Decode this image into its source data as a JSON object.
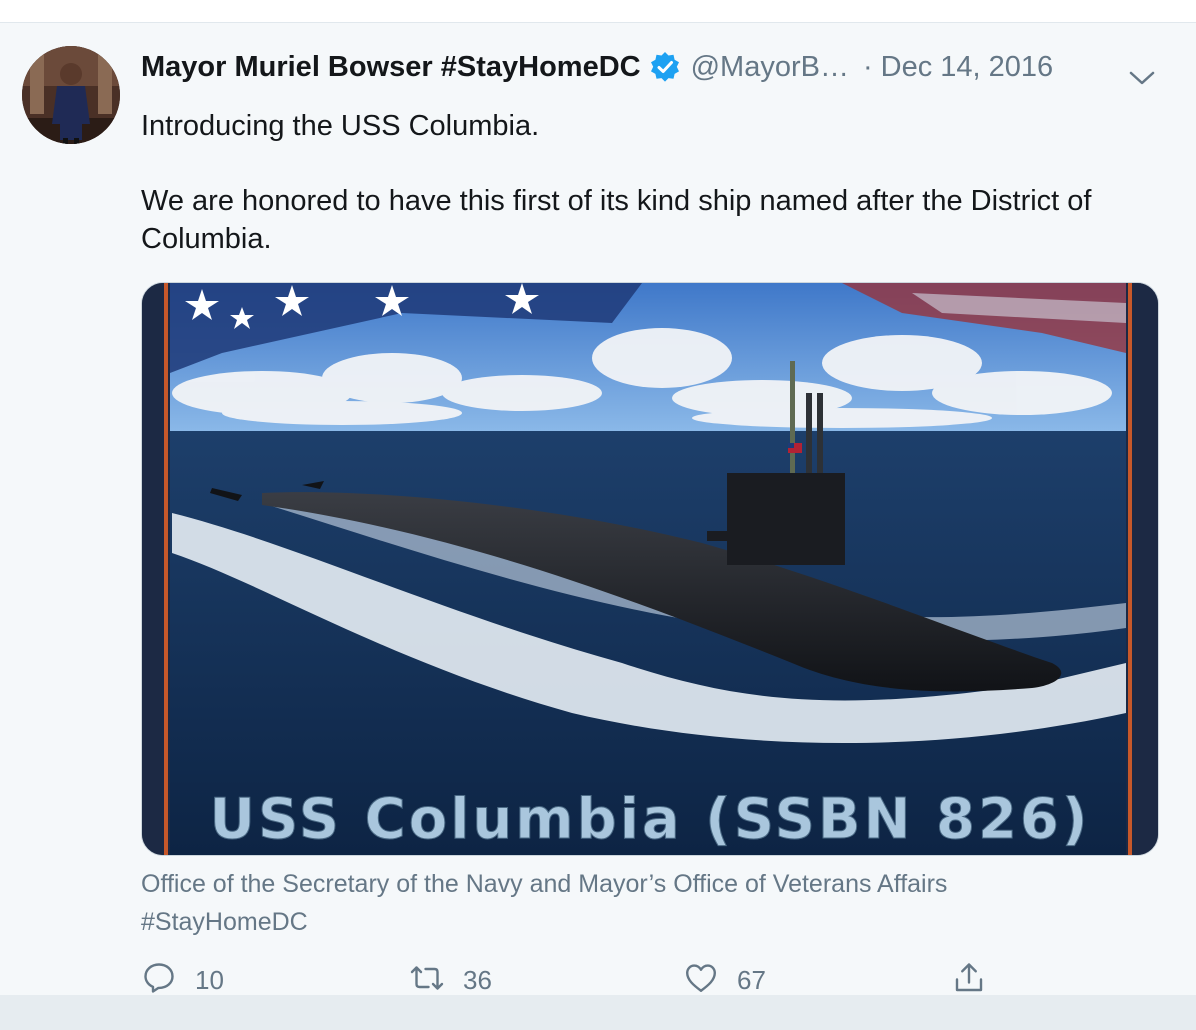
{
  "tweet": {
    "author_name": "Mayor Muriel Bowser #StayHomeDC",
    "handle": "@MayorB…",
    "separator": "·",
    "date": "Dec 14, 2016",
    "text_lines": [
      "Introducing the USS Columbia.",
      "We are honored to have this first of its kind ship named after the District of Columbia."
    ],
    "media": {
      "banner_text": "USS Columbia (SSBN 826)"
    },
    "caption": {
      "line1": "Office of the Secretary of the Navy and Mayor’s Office of Veterans Affairs",
      "line2": "#StayHomeDC"
    },
    "actions": {
      "reply_count": "10",
      "retweet_count": "36",
      "like_count": "67"
    },
    "icons": {
      "verified": "verified-badge-icon",
      "caret": "chevron-down-icon",
      "reply": "reply-icon",
      "retweet": "retweet-icon",
      "like": "heart-icon",
      "share": "share-icon"
    },
    "colors": {
      "accent": "#1da1f2",
      "secondary_text": "#657786",
      "background": "#f5f8fa"
    }
  }
}
